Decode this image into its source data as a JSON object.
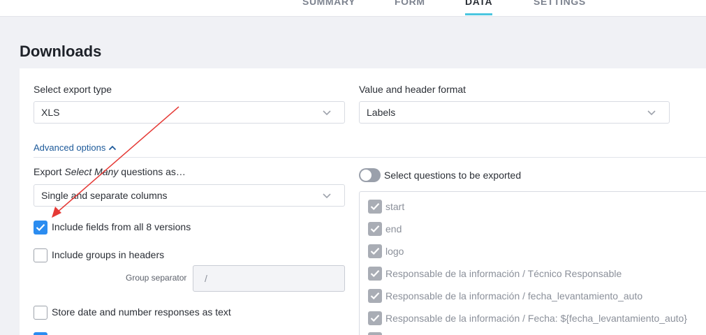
{
  "nav": {
    "tabs": [
      {
        "label": "SUMMARY"
      },
      {
        "label": "FORM"
      },
      {
        "label": "DATA"
      },
      {
        "label": "SETTINGS"
      }
    ],
    "active_tab": "DATA"
  },
  "page": {
    "title": "Downloads"
  },
  "export": {
    "type_label": "Select export type",
    "type_value": "XLS",
    "format_label": "Value and header format",
    "format_value": "Labels"
  },
  "advanced": {
    "toggle_label": "Advanced options",
    "select_many_prefix": "Export ",
    "select_many_em": "Select Many",
    "select_many_suffix": " questions as…",
    "select_many_value": "Single and separate columns",
    "include_versions_label": "Include fields from all 8 versions",
    "include_versions_checked": true,
    "include_groups_label": "Include groups in headers",
    "include_groups_checked": false,
    "group_separator_label": "Group separator",
    "group_separator_value": "/",
    "store_as_text_label": "Store date and number responses as text",
    "store_as_text_checked": false
  },
  "questions": {
    "toggle_label": "Select questions to be exported",
    "toggle_on": false,
    "items": [
      {
        "label": "start",
        "checked": true
      },
      {
        "label": "end",
        "checked": true
      },
      {
        "label": "logo",
        "checked": true
      },
      {
        "label": "Responsable de la información / Técnico Responsable",
        "checked": true
      },
      {
        "label": "Responsable de la información / fecha_levantamiento_auto",
        "checked": true
      },
      {
        "label": "Responsable de la información / Fecha: ${fecha_levantamiento_auto}",
        "checked": true
      }
    ]
  },
  "colors": {
    "accent": "#2b8cf0",
    "tab_underline": "#4bc6e0",
    "link": "#1d5a9a",
    "annotation_arrow": "#e53935"
  }
}
